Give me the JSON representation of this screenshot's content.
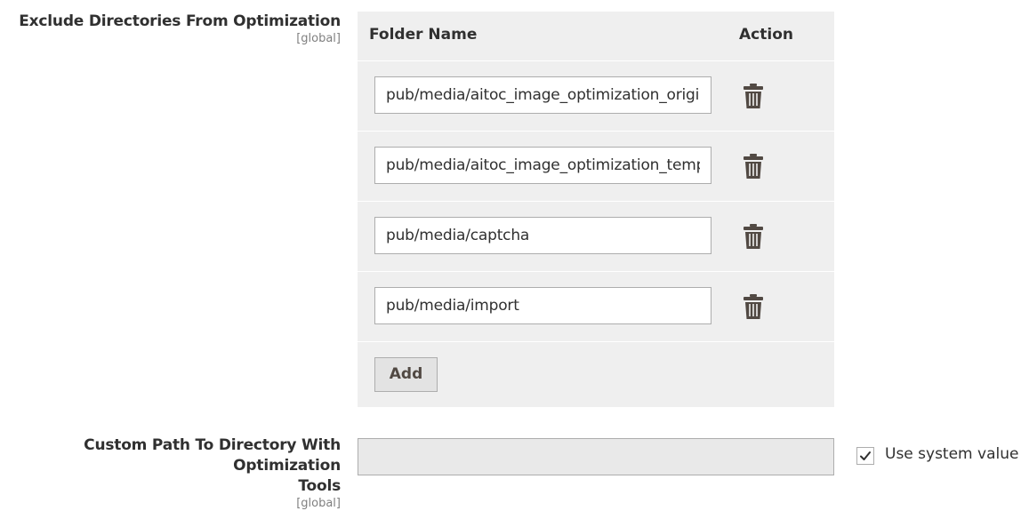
{
  "exclude_dirs": {
    "label": "Exclude Directories From Optimization",
    "scope": "[global]",
    "columns": {
      "folder": "Folder Name",
      "action": "Action"
    },
    "rows": [
      {
        "value": "pub/media/aitoc_image_optimization_original"
      },
      {
        "value": "pub/media/aitoc_image_optimization_temp"
      },
      {
        "value": "pub/media/captcha"
      },
      {
        "value": "pub/media/import"
      }
    ],
    "add_label": "Add",
    "delete_icon": "trash-icon"
  },
  "custom_path": {
    "label_line1": "Custom Path To Directory With Optimization",
    "label_line2": "Tools",
    "scope": "[global]",
    "value": "",
    "use_system_value_label": "Use system value",
    "use_system_value_checked": true
  },
  "colors": {
    "grid_bg": "#efefef",
    "input_border": "#adadad",
    "text": "#303030",
    "icon": "#514943"
  }
}
